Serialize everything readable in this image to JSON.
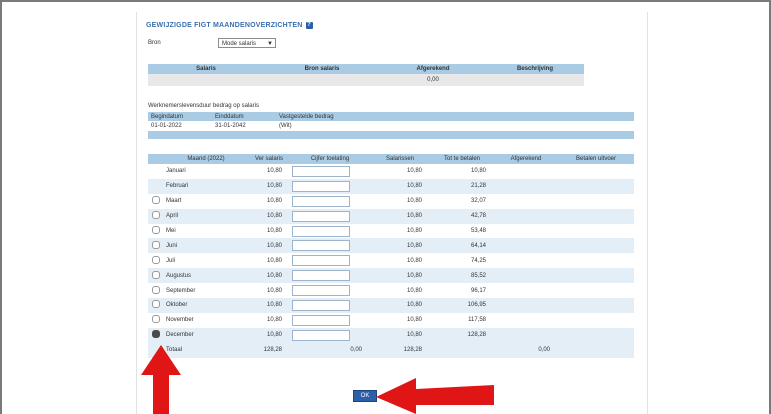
{
  "title": "GEWIJZIGDE FIGT MAANDENOVERZICHTEN",
  "period_label": "Bron",
  "period_value": "Mode salaris",
  "table1": {
    "headers": [
      "Salaris",
      "Bron salaris",
      "Afgerekend",
      "Beschrijving"
    ],
    "row": [
      "",
      "",
      "0,00",
      ""
    ]
  },
  "employer_section_label": "Werknemerslevensduur bedrag op salaris",
  "table2": {
    "headers": [
      "Begindatum",
      "Einddatum",
      "Vastgestelde bedrag"
    ],
    "row": [
      "01-01-2022",
      "31-01-2042",
      "(Wit)"
    ]
  },
  "months_table": {
    "headers": [
      "",
      "Maand (2022)",
      "Ver salaris",
      "Cijfer toelating",
      "Salarissen",
      "Tot te betalen",
      "Afgerekend",
      "Betalen uitvoer"
    ],
    "rows": [
      {
        "month": "Januari",
        "salary": "10,80",
        "salary2": "10,80",
        "total": "10,80",
        "checked": false
      },
      {
        "month": "Februari",
        "salary": "10,80",
        "salary2": "10,80",
        "total": "21,28",
        "checked": false
      },
      {
        "month": "Maart",
        "salary": "10,80",
        "salary2": "10,80",
        "total": "32,07",
        "checked": false
      },
      {
        "month": "April",
        "salary": "10,80",
        "salary2": "10,80",
        "total": "42,78",
        "checked": false
      },
      {
        "month": "Mei",
        "salary": "10,80",
        "salary2": "10,80",
        "total": "53,48",
        "checked": false
      },
      {
        "month": "Juni",
        "salary": "10,80",
        "salary2": "10,80",
        "total": "64,14",
        "checked": false
      },
      {
        "month": "Juli",
        "salary": "10,80",
        "salary2": "10,80",
        "total": "74,25",
        "checked": false
      },
      {
        "month": "Augustus",
        "salary": "10,80",
        "salary2": "10,80",
        "total": "85,52",
        "checked": false
      },
      {
        "month": "September",
        "salary": "10,80",
        "salary2": "10,80",
        "total": "96,17",
        "checked": false
      },
      {
        "month": "Oktober",
        "salary": "10,80",
        "salary2": "10,80",
        "total": "106,95",
        "checked": false
      },
      {
        "month": "November",
        "salary": "10,80",
        "salary2": "10,80",
        "total": "117,58",
        "checked": false
      },
      {
        "month": "December",
        "salary": "10,80",
        "salary2": "10,80",
        "total": "128,28",
        "checked": true
      }
    ],
    "total": {
      "label": "Totaal",
      "salary": "128,28",
      "mid": "0,00",
      "salary2": "128,28",
      "paid": "0,00"
    }
  },
  "ok_label": "OK",
  "colors": {
    "header_blue": "#a9cbe4",
    "row_alt": "#e4eef7",
    "arrow_red": "#e01515",
    "title_blue": "#3b6fb0"
  }
}
